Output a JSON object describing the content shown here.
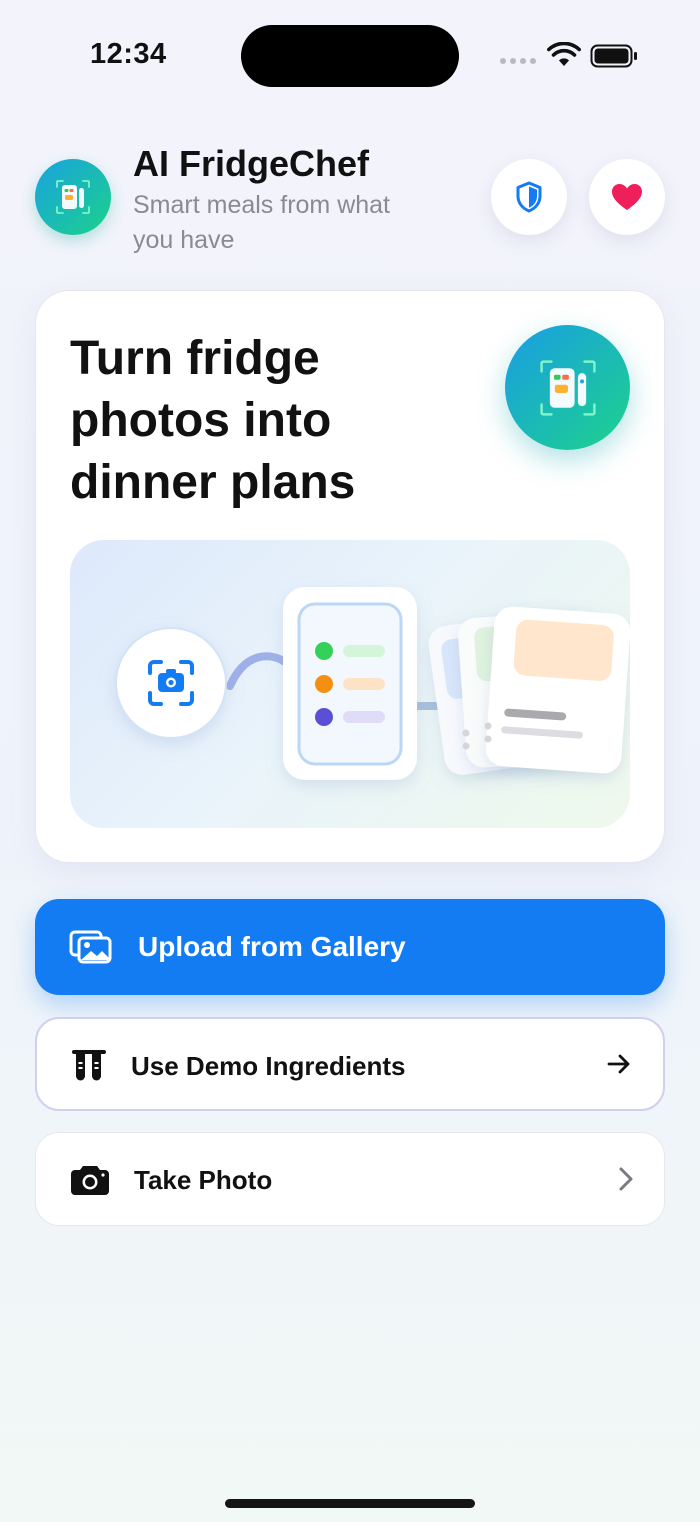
{
  "status_bar": {
    "time": "12:34"
  },
  "header": {
    "app_name": "AI FridgeChef",
    "tagline": "Smart meals from what you have",
    "privacy_icon": "shield-icon",
    "favorites_icon": "heart-icon"
  },
  "hero": {
    "title": "Turn fridge photos into dinner plans",
    "illustration_steps": [
      "camera-scan-icon",
      "ingredient-list-card",
      "recipe-cards"
    ],
    "ingredient_dot_colors": [
      "#34d158",
      "#f39014",
      "#5b4fd6"
    ]
  },
  "actions": {
    "upload": {
      "label": "Upload from Gallery",
      "icon": "gallery-icon"
    },
    "demo": {
      "label": "Use Demo Ingredients",
      "icon": "test-tubes-icon",
      "trailing_icon": "arrow-right-icon"
    },
    "photo": {
      "label": "Take Photo",
      "icon": "camera-icon",
      "trailing_icon": "chevron-right-icon"
    }
  },
  "colors": {
    "accent": "#147cf2",
    "brand_gradient_start": "#1a9de4",
    "brand_gradient_end": "#1cd38b",
    "heart": "#ee1f5b"
  }
}
